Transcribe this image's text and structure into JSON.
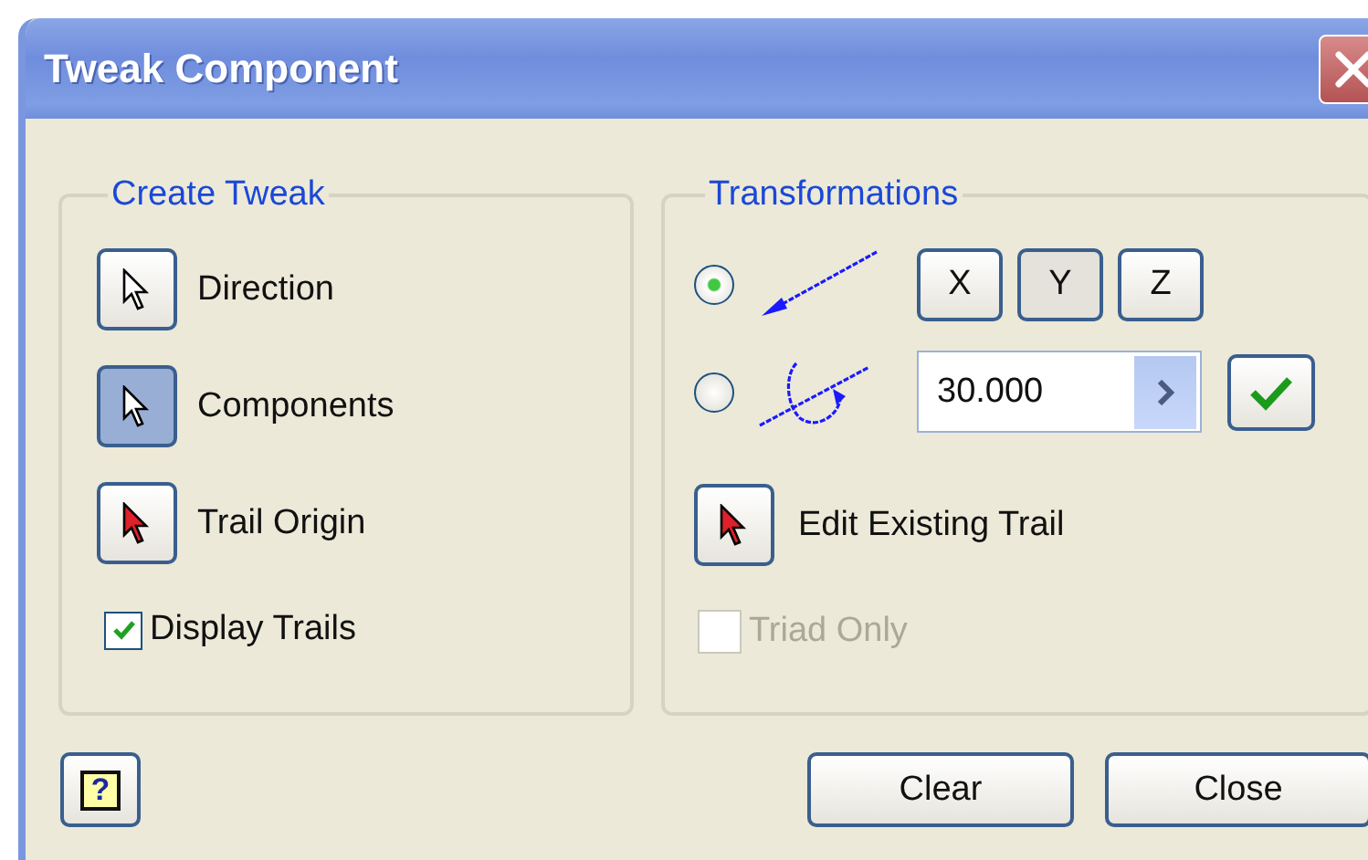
{
  "window": {
    "title": "Tweak Component"
  },
  "create_tweak": {
    "title": "Create Tweak",
    "tools": [
      {
        "label": "Direction",
        "selected": false,
        "kind": "plain"
      },
      {
        "label": "Components",
        "selected": true,
        "kind": "plain"
      },
      {
        "label": "Trail Origin",
        "selected": false,
        "kind": "red"
      }
    ],
    "display_trails": {
      "label": "Display Trails",
      "checked": true
    }
  },
  "transformations": {
    "title": "Transformations",
    "modes": [
      {
        "kind": "axis",
        "selected": true
      },
      {
        "kind": "rotate",
        "selected": false
      }
    ],
    "axes": [
      {
        "label": "X",
        "selected": false
      },
      {
        "label": "Y",
        "selected": true
      },
      {
        "label": "Z",
        "selected": false
      }
    ],
    "angle": {
      "value": "30.000"
    },
    "edit_trail": {
      "label": "Edit Existing Trail"
    },
    "triad_only": {
      "label": "Triad Only",
      "checked": false,
      "disabled": true
    }
  },
  "help_button": {
    "label": "?"
  },
  "buttons": [
    "Clear",
    "Close"
  ]
}
